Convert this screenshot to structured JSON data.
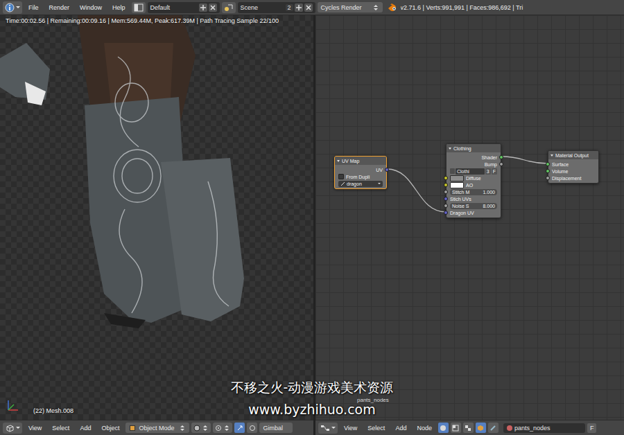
{
  "top_bar": {
    "menus": [
      "File",
      "Render",
      "Window",
      "Help"
    ],
    "layout": "Default",
    "scene": "Scene",
    "scene_users": "2",
    "engine": "Cycles Render",
    "stats": "v2.71.6 | Verts:991,991 | Faces:986,692 | Tri"
  },
  "viewport": {
    "render_info": "Time:00:02.56 | Remaining:00:09.16 | Mem:569.44M, Peak:617.39M | Path Tracing Sample 22/100",
    "object_label": "(22) Mesh.008"
  },
  "node_editor": {
    "tree_label": "pants_nodes",
    "nodes": [
      {
        "title": "UV Map",
        "selected": true,
        "rows": [
          {
            "kind": "output",
            "label": "UV",
            "color": "#6363c7"
          },
          {
            "kind": "checkbox",
            "label": "From Dupli",
            "checked": false
          },
          {
            "kind": "field",
            "value": "dragon"
          }
        ]
      },
      {
        "title": "Clothing",
        "selected": false,
        "rows": [
          {
            "kind": "output",
            "label": "Shader",
            "color": "#63c763"
          },
          {
            "kind": "output",
            "label": "Bump",
            "color": "#a1a1a1"
          },
          {
            "kind": "group",
            "name": "Clothi",
            "users": "3",
            "fake_user": "F"
          },
          {
            "kind": "color",
            "label": "Diffuse",
            "color": "#c7c729",
            "swatch": "#8c8c8c"
          },
          {
            "kind": "color",
            "label": "AO",
            "color": "#c7c729",
            "swatch": "#ffffff"
          },
          {
            "kind": "value",
            "label": "Stitch M",
            "value": "1.000",
            "color": "#a1a1a1"
          },
          {
            "kind": "input",
            "label": "Stich UVs",
            "color": "#6363c7"
          },
          {
            "kind": "value",
            "label": "Noise S",
            "value": "8.000",
            "color": "#a1a1a1"
          },
          {
            "kind": "input",
            "label": "Dragon UV",
            "color": "#6363c7"
          }
        ]
      },
      {
        "title": "Material Output",
        "selected": false,
        "rows": [
          {
            "kind": "input",
            "label": "Surface",
            "color": "#63c763"
          },
          {
            "kind": "input",
            "label": "Volume",
            "color": "#63c763"
          },
          {
            "kind": "input",
            "label": "Displacement",
            "color": "#a1a1a1"
          }
        ]
      }
    ],
    "links": [
      {
        "from_node": 0,
        "from_row": 0,
        "to_node": 1,
        "to_row": 8
      },
      {
        "from_node": 1,
        "from_row": 0,
        "to_node": 2,
        "to_row": 0
      }
    ]
  },
  "viewport_header": {
    "menus": [
      "View",
      "Select",
      "Add",
      "Object"
    ],
    "mode": "Object Mode",
    "orientation": "Gimbal"
  },
  "node_header": {
    "menus": [
      "View",
      "Select",
      "Add",
      "Node"
    ],
    "tree": "pants_nodes",
    "fake_user": "F"
  },
  "watermark": {
    "title": "不移之火-动漫游戏美术资源",
    "url": "www.byzhihuo.com"
  }
}
